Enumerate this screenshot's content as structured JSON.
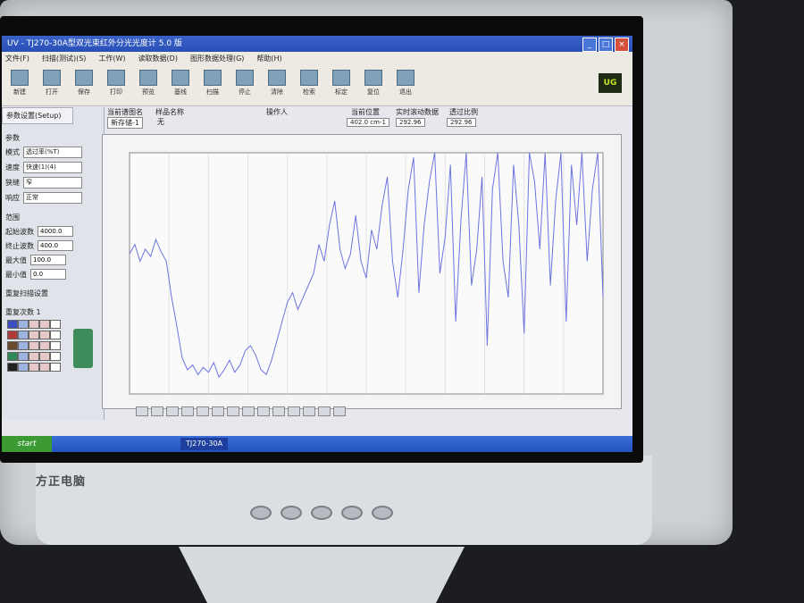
{
  "window": {
    "title": "UV - TJ270-30A型双光束红外分光光度计 5.0 版"
  },
  "menu": [
    "文件(F)",
    "扫描(测试)(S)",
    "工作(W)",
    "读取数据(D)",
    "图形数据处理(G)",
    "帮助(H)"
  ],
  "toolbar": [
    "新建",
    "打开",
    "保存",
    "打印",
    "预览",
    "基线",
    "扫描",
    "停止",
    "清除",
    "检索",
    "标定",
    "复位",
    "退出"
  ],
  "logo_text": "UG",
  "left_panel": {
    "tab": "参数设置(Setup)",
    "group": "参数",
    "fields": [
      {
        "label": "模式",
        "value": "透过率(%T)"
      },
      {
        "label": "速度",
        "value": "快速(1)(4)"
      },
      {
        "label": "狭缝",
        "value": "窄"
      },
      {
        "label": "响应",
        "value": "正常"
      }
    ],
    "range_title": "范围",
    "ranges": [
      {
        "label": "起始波数",
        "value": "4000.0"
      },
      {
        "label": "终止波数",
        "value": "400.0"
      },
      {
        "label": "最大值",
        "value": "100.0"
      },
      {
        "label": "最小值",
        "value": "0.0"
      }
    ],
    "repeat": "重复扫描设置",
    "repeat_count": "重复次数 1"
  },
  "info": {
    "col1": "当前谱图名",
    "col2": "样品名称",
    "col3": "操作人",
    "val1": "新存储-1",
    "val2": "无",
    "pos_label": "当前位置",
    "pos_value": "402.0 cm-1",
    "ratio_label": "实时滚动数据",
    "ratio_value": "292.96",
    "t_label": "透过比例",
    "t_value": "292.96"
  },
  "taskbar": {
    "start": "start",
    "item": "TJ270-30A"
  },
  "brand": "方正电脑",
  "chart_data": {
    "type": "line",
    "series": [
      {
        "values": [
          58,
          62,
          55,
          60,
          57,
          64,
          59,
          55,
          40,
          28,
          15,
          10,
          12,
          8,
          11,
          9,
          13,
          7,
          10,
          14,
          9,
          12,
          18,
          20,
          16,
          10,
          8,
          14,
          22,
          30,
          38,
          42,
          35,
          40,
          45,
          50,
          62,
          55,
          70,
          80,
          60,
          52,
          58,
          74,
          55,
          48,
          68,
          60,
          78,
          90,
          55,
          40,
          60,
          85,
          98,
          42,
          70,
          88,
          100,
          50,
          65,
          95,
          30,
          72,
          100,
          45,
          60,
          90,
          20,
          85,
          100,
          55,
          40,
          95,
          70,
          25,
          100,
          88,
          60,
          100,
          45,
          80,
          100,
          30,
          95,
          70,
          100,
          55,
          85,
          100,
          40
        ]
      }
    ]
  }
}
